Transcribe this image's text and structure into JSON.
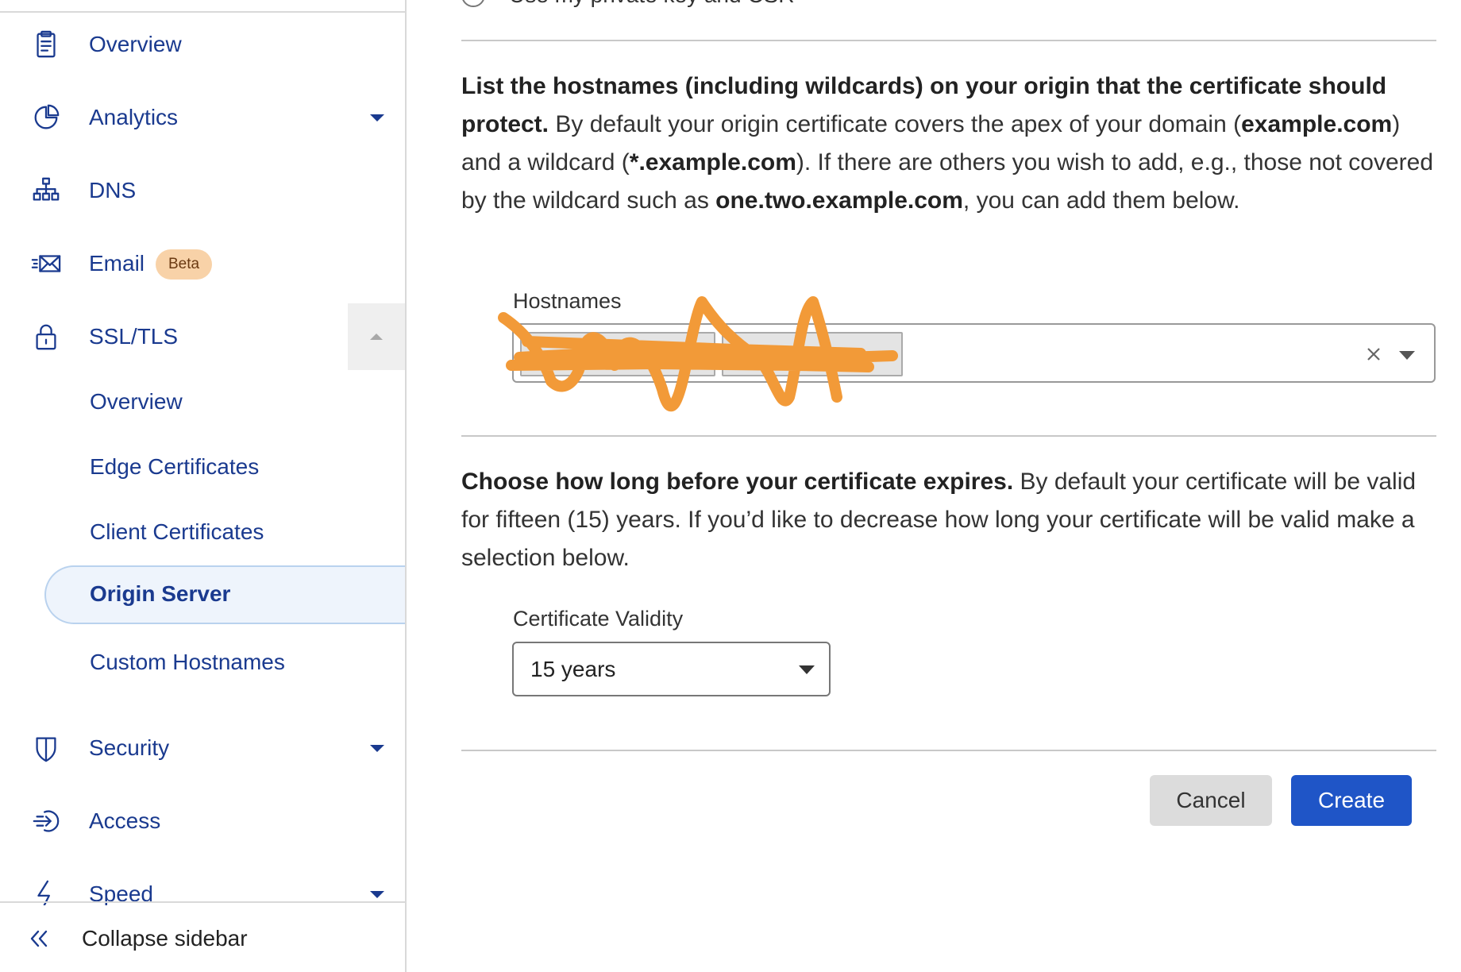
{
  "sidebar": {
    "items": [
      {
        "label": "Overview"
      },
      {
        "label": "Analytics"
      },
      {
        "label": "DNS"
      },
      {
        "label": "Email",
        "badge": "Beta"
      },
      {
        "label": "SSL/TLS"
      },
      {
        "label": "Security"
      },
      {
        "label": "Access"
      },
      {
        "label": "Speed"
      }
    ],
    "ssl_subitems": [
      {
        "label": "Overview"
      },
      {
        "label": "Edge Certificates"
      },
      {
        "label": "Client Certificates"
      },
      {
        "label": "Origin Server",
        "active": true
      },
      {
        "label": "Custom Hostnames"
      }
    ],
    "collapse_label": "Collapse sidebar"
  },
  "main": {
    "radio_option": "Use my private key and CSR",
    "hostnames_section": {
      "heading_bold": "List the hostnames (including wildcards) on your origin that the certificate should protect.",
      "text_1": " By default your origin certificate covers the apex of your domain (",
      "example_apex": "example.com",
      "text_2": ") and a wildcard (",
      "example_wildcard": "*.example.com",
      "text_3": "). If there are others you wish to add, e.g., those not covered by the wildcard such as ",
      "example_sub": "one.two.example.com",
      "text_4": ", you can add them below.",
      "field_label": "Hostnames"
    },
    "validity_section": {
      "heading_bold": "Choose how long before your certificate expires.",
      "text": " By default your certificate will be valid for fifteen (15) years. If you’d like to decrease how long your certificate will be valid make a selection below.",
      "field_label": "Certificate Validity",
      "selected_value": "15 years"
    },
    "buttons": {
      "cancel": "Cancel",
      "create": "Create"
    }
  },
  "colors": {
    "nav_text": "#1a3a8f",
    "primary_button": "#1f55c7",
    "badge_bg": "#f8d2a8",
    "redaction_scribble": "#f29a38"
  }
}
